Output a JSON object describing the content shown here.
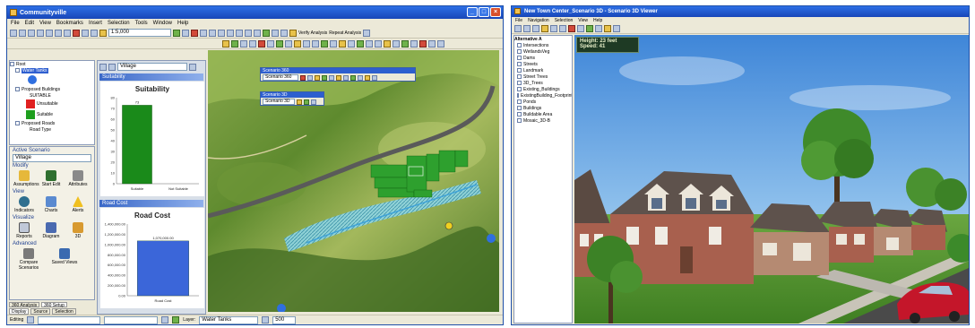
{
  "left_window": {
    "title": "Communityville",
    "menu": [
      "File",
      "Edit",
      "View",
      "Bookmarks",
      "Insert",
      "Selection",
      "Tools",
      "Window",
      "Help"
    ],
    "scale_value": "1:5,000",
    "toolbar_right": [
      "Verify Analysis",
      "Repeat Analysis"
    ],
    "toc": {
      "root": "Root",
      "items": [
        "Water Tanks",
        "Proposed Buildings",
        "SUITABLE",
        "Unsuitable",
        "Suitable",
        "Proposed Roads",
        "Road Type"
      ]
    },
    "active_scenario_label": "Active Scenario",
    "active_scenario_value": "Village",
    "groups": {
      "modify": {
        "label": "Modify",
        "buttons": [
          "Assumptions",
          "Start Edit",
          "Attributes"
        ]
      },
      "view": {
        "label": "View",
        "buttons": [
          "Indicators",
          "Charts",
          "Alerts"
        ]
      },
      "visualize": {
        "label": "Visualize",
        "buttons": [
          "Reports",
          "Diagram",
          "3D"
        ]
      },
      "advanced": {
        "label": "Advanced",
        "buttons": [
          "Compare Scenarios",
          "Saved Views"
        ]
      }
    },
    "bottom_tabs": [
      "Display",
      "Source",
      "Selection"
    ],
    "bottom_tabs2": [
      "360 Analysis",
      "360 Setup"
    ],
    "chart_combo": "Village",
    "suitability_header": "Suitability",
    "suitability_title": "Suitability",
    "roadcost_header": "Road Cost",
    "roadcost_title": "Road Cost",
    "float_toolbar_1": {
      "title": "Scenario 360",
      "combo": "Scenario 360"
    },
    "float_toolbar_2": {
      "title": "Scenario 3D",
      "combo": "Scenario 3D"
    },
    "status": {
      "editor": "Editing",
      "layer_label": "Layer:",
      "layer_value": "Water Tanks",
      "zoom": "500"
    },
    "colors": {
      "unsuitable": "#e02020",
      "suitable": "#1e9e1e",
      "bar_suitable": "#1a8a1a",
      "bar_roadcost": "#3b66d9"
    }
  },
  "chart_data": [
    {
      "type": "bar",
      "title": "Suitability",
      "categories": [
        "Suitable",
        "Not Suitable"
      ],
      "values": [
        73,
        0
      ],
      "data_labels": [
        "73",
        ""
      ],
      "ylim": [
        0,
        80
      ],
      "yticks": [
        0,
        10,
        20,
        30,
        40,
        50,
        60,
        70,
        80
      ],
      "xlabel": "",
      "ylabel": ""
    },
    {
      "type": "bar",
      "title": "Road Cost",
      "categories": [
        "Road Cost"
      ],
      "values": [
        1070000
      ],
      "data_labels": [
        "1,070,000.00"
      ],
      "ylim": [
        0,
        1400000
      ],
      "yticks": [
        "0.00",
        "200,000.00",
        "400,000.00",
        "600,000.00",
        "800,000.00",
        "1,000,000.00",
        "1,200,000.00",
        "1,400,000.00"
      ],
      "xlabel": "",
      "ylabel": ""
    }
  ],
  "right_window": {
    "title": "New Town Center_Scenario 3D - Scenario 3D Viewer",
    "menu": [
      "File",
      "Navigation",
      "Selection",
      "View",
      "Help"
    ],
    "tree_root": "Alternative A",
    "tree_items": [
      "Intersections",
      "WetlandsVeg",
      "Dams",
      "Streets",
      "Landmark",
      "Street Trees",
      "3D_Trees",
      "Existing_Buildings",
      "ExistingBuilding_Footprint",
      "Ponds",
      "Buildings",
      "Buildable Area",
      "Mosaic_3D-B"
    ],
    "hud_height": "Height: 23 feet",
    "hud_speed": "Speed: 41"
  }
}
